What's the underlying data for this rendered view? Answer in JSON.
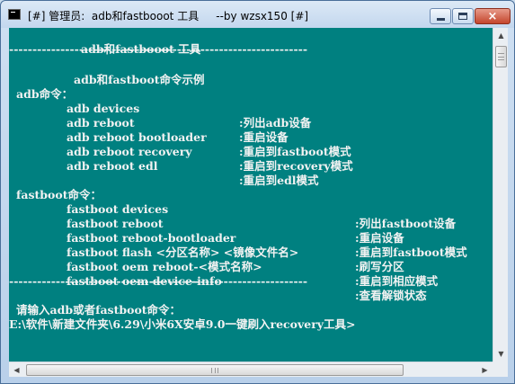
{
  "window": {
    "title": "[#] 管理员:  adb和fastbooot 工具     --by wzsx150 [#]",
    "controls": {
      "minimize": "minimize",
      "maximize": "maximize",
      "close": "×"
    }
  },
  "console": {
    "header_title": "adb和fastbooot 工具",
    "separator": "----------------------------------------------------------------",
    "examples_title": "adb和fastboot命令示例",
    "adb_section_label": "adb命令：",
    "adb_commands": [
      {
        "cmd": "adb devices",
        "desc": ":列出adb设备"
      },
      {
        "cmd": "adb reboot",
        "desc": ":重启设备"
      },
      {
        "cmd": "adb reboot bootloader",
        "desc": ":重启到fastboot模式"
      },
      {
        "cmd": "adb reboot recovery",
        "desc": ":重启到recovery模式"
      },
      {
        "cmd": "adb reboot edl",
        "desc": ":重启到edl模式"
      }
    ],
    "fastboot_section_label": "fastboot命令：",
    "fastboot_commands": [
      {
        "cmd": "fastboot devices",
        "desc": ":列出fastboot设备"
      },
      {
        "cmd": "fastboot reboot",
        "desc": ":重启设备"
      },
      {
        "cmd": "fastboot reboot-bootloader",
        "desc": ":重启到fastboot模式"
      },
      {
        "cmd": "fastboot flash <分区名称> <镜像文件名>",
        "desc": ":刷写分区"
      },
      {
        "cmd": "fastboot oem reboot-<模式名称>",
        "desc": ":重启到相应模式"
      },
      {
        "cmd": "fastboot oem device-info",
        "desc": ":查看解锁状态"
      }
    ],
    "input_prompt": "请输入adb或者fastboot命令：",
    "shell_prompt": "E:\\软件\\新建文件夹\\6.29\\小米6X安卓9.0一键刷入recovery工具>"
  },
  "scrollbars": {
    "up_arrow": "▲",
    "down_arrow": "▼",
    "left_arrow": "◀",
    "right_arrow": "▶"
  }
}
